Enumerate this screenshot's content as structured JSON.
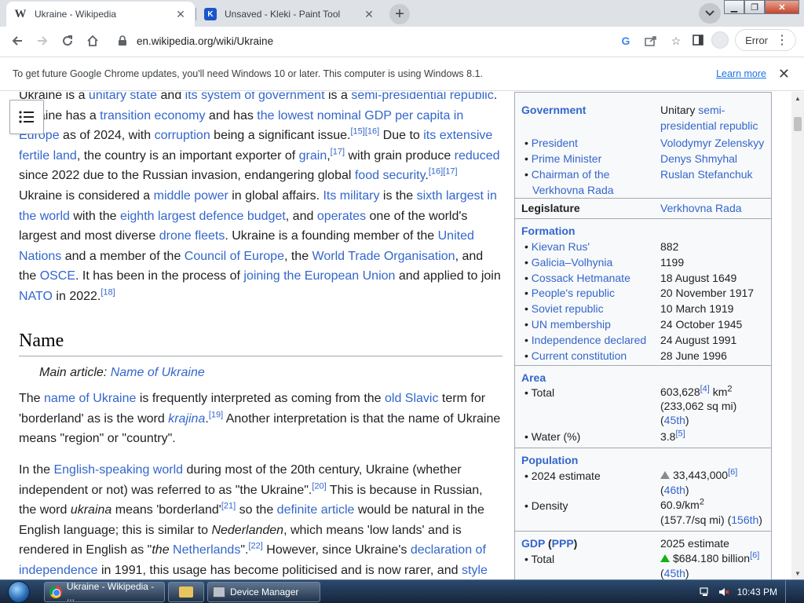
{
  "tabs": [
    {
      "title": "Ukraine - Wikipedia",
      "favicon": "W",
      "active": true
    },
    {
      "title": "Unsaved - Kleki - Paint Tool",
      "favicon": "K",
      "active": false
    }
  ],
  "toolbar": {
    "url": "en.wikipedia.org/wiki/Ukraine",
    "error_label": "Error"
  },
  "infobar": {
    "message": "To get future Google Chrome updates, you'll need Windows 10 or later. This computer is using Windows 8.1.",
    "learn_more": "Learn more"
  },
  "article": {
    "heading_name": "Name",
    "hatnote_prefix": "Main article: ",
    "hatnote_link": "Name of Ukraine"
  },
  "infobox": {
    "government": {
      "label": "Government",
      "value_plain": "Unitary ",
      "value_link": "semi-presidential republic",
      "rows": [
        {
          "label": "President",
          "value": "Volodymyr Zelenskyy"
        },
        {
          "label": "Prime Minister",
          "value": "Denys Shmyhal"
        },
        {
          "label": "Chairman of the Verkhovna Rada",
          "value": "Ruslan Stefanchuk"
        }
      ]
    },
    "legislature": {
      "label": "Legislature",
      "value": "Verkhovna Rada"
    },
    "formation": {
      "label": "Formation",
      "rows": [
        {
          "label": "Kievan Rus'",
          "value": "882"
        },
        {
          "label": "Galicia–Volhynia",
          "value": "1199"
        },
        {
          "label": "Cossack Hetmanate",
          "value": "18 August 1649"
        },
        {
          "label": "People's republic",
          "value": "20 November 1917"
        },
        {
          "label": "Soviet republic",
          "value": "10 March 1919"
        },
        {
          "label": "UN membership",
          "value": "24 October 1945"
        },
        {
          "label": "Independence declared",
          "value": "24 August 1991"
        },
        {
          "label": "Current constitution",
          "value": "28 June 1996"
        }
      ]
    },
    "area": {
      "label": "Area",
      "total_label": "• Total",
      "total_value": "603,628",
      "total_ref": "[4]",
      "total_unit": " km",
      "total_sqmi": "(233,062 sq mi)",
      "total_rank": "45th",
      "water_label": "• Water (%)",
      "water_value": "3.8",
      "water_ref": "[5]"
    },
    "population": {
      "label": "Population",
      "estimate_label": "• 2024 estimate",
      "estimate_value": "33,443,000",
      "estimate_ref": "[6]",
      "estimate_rank": "46th",
      "density_label": "• Density",
      "density_value": "60.9/km",
      "density_sqmi": "(157.7/sq mi) (",
      "density_rank": "156th"
    },
    "gdp": {
      "label": "GDP",
      "label_link": "PPP",
      "estimate": "2025 estimate",
      "total_label": "• Total",
      "total_value": "$684.180 billion",
      "total_ref": "[6]",
      "total_rank": "45th"
    }
  },
  "taskbar": {
    "items": [
      "Ukraine - Wikipedia - ...",
      "",
      "Device Manager"
    ],
    "clock": "10:43 PM"
  }
}
